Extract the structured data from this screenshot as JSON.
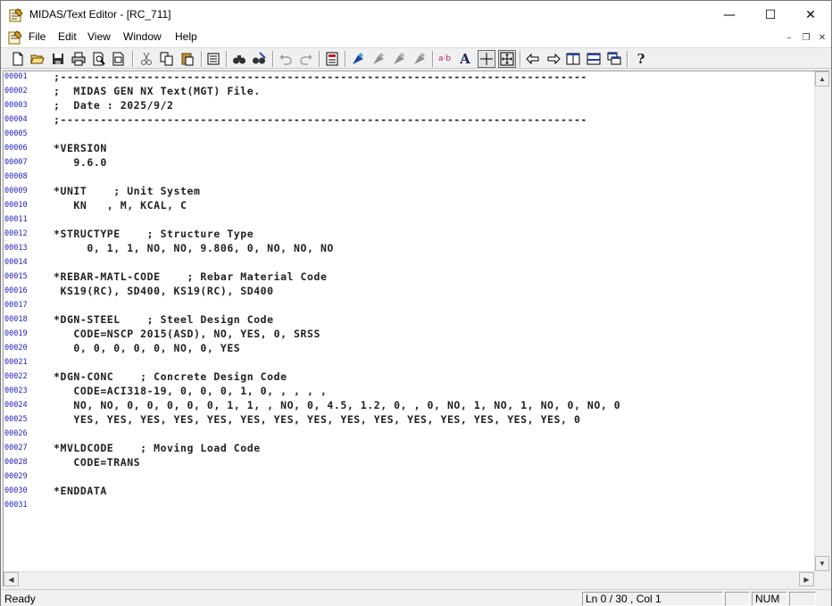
{
  "window": {
    "title": "MIDAS/Text Editor - [RC_711]",
    "controls": {
      "minimize": "—",
      "maximize": "☐",
      "close": "✕"
    }
  },
  "menu": {
    "items": [
      "File",
      "Edit",
      "View",
      "Window",
      "Help"
    ],
    "mdi_controls": {
      "minimize": "–",
      "restore": "❐",
      "close": "✕"
    }
  },
  "toolbar": {
    "icons": [
      "new-file-icon",
      "open-folder-icon",
      "save-icon",
      "print-icon",
      "print-preview-icon",
      "page-setup-icon",
      "cut-icon",
      "copy-icon",
      "paste-icon",
      "properties-icon",
      "find-icon",
      "replace-icon",
      "undo-icon",
      "redo-icon",
      "column-icon",
      "bookmark-icon",
      "bookmark-next-icon",
      "bookmark-prev-icon",
      "bookmark-clear-icon",
      "ab-swap-icon",
      "font-icon",
      "crosshair-icon",
      "fit-icon",
      "indent-left-icon",
      "indent-right-icon",
      "split-vertical-icon",
      "split-horizontal-icon",
      "cascade-icon",
      "help-icon"
    ],
    "ab_label": "a·b",
    "font_label": "A",
    "help_label": "?"
  },
  "editor": {
    "lines": [
      ";-------------------------------------------------------------------------------",
      ";  MIDAS GEN NX Text(MGT) File.",
      ";  Date : 2025/9/2",
      ";-------------------------------------------------------------------------------",
      "",
      "*VERSION",
      "   9.6.0",
      "",
      "*UNIT    ; Unit System",
      "   KN   , M, KCAL, C",
      "",
      "*STRUCTYPE    ; Structure Type",
      "     0, 1, 1, NO, NO, 9.806, 0, NO, NO, NO",
      "",
      "*REBAR-MATL-CODE    ; Rebar Material Code",
      " KS19(RC), SD400, KS19(RC), SD400",
      "",
      "*DGN-STEEL    ; Steel Design Code",
      "   CODE=NSCP 2015(ASD), NO, YES, 0, SRSS",
      "   0, 0, 0, 0, 0, NO, 0, YES",
      "",
      "*DGN-CONC    ; Concrete Design Code",
      "   CODE=ACI318-19, 0, 0, 0, 1, 0, , , , ,",
      "   NO, NO, 0, 0, 0, 0, 0, 1, 1, , NO, 0, 4.5, 1.2, 0, , 0, NO, 1, NO, 1, NO, 0, NO, 0",
      "   YES, YES, YES, YES, YES, YES, YES, YES, YES, YES, YES, YES, YES, YES, YES, 0",
      "",
      "*MVLDCODE    ; Moving Load Code",
      "   CODE=TRANS",
      "",
      "*ENDDATA",
      ""
    ],
    "line_numbers": [
      "00001",
      "00002",
      "00003",
      "00004",
      "00005",
      "00006",
      "00007",
      "00008",
      "00009",
      "00010",
      "00011",
      "00012",
      "00013",
      "00014",
      "00015",
      "00016",
      "00017",
      "00018",
      "00019",
      "00020",
      "00021",
      "00022",
      "00023",
      "00024",
      "00025",
      "00026",
      "00027",
      "00028",
      "00029",
      "00030",
      "00031"
    ]
  },
  "scrollbars": {
    "up": "▲",
    "down": "▼",
    "left": "◀",
    "right": "▶"
  },
  "status": {
    "text": "Ready",
    "position": "Ln 0 / 30 , Col 1",
    "num": "NUM"
  }
}
